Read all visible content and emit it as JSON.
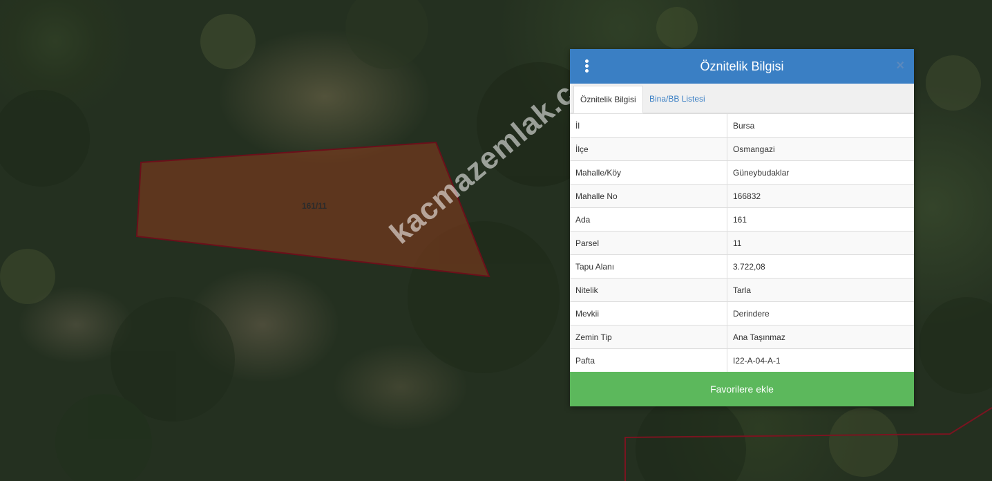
{
  "map": {
    "parcel_label": "161/11",
    "watermark": "kacmazemlak.com"
  },
  "panel": {
    "title": "Öznitelik Bilgisi",
    "close_label": "×",
    "tabs": [
      {
        "label": "Öznitelik Bilgisi",
        "active": true
      },
      {
        "label": "Bina/BB Listesi",
        "active": false
      }
    ],
    "rows": [
      {
        "key": "İl",
        "value": "Bursa"
      },
      {
        "key": "İlçe",
        "value": "Osmangazi"
      },
      {
        "key": "Mahalle/Köy",
        "value": "Güneybudaklar"
      },
      {
        "key": "Mahalle No",
        "value": "166832"
      },
      {
        "key": "Ada",
        "value": "161"
      },
      {
        "key": "Parsel",
        "value": "11"
      },
      {
        "key": "Tapu Alanı",
        "value": "3.722,08"
      },
      {
        "key": "Nitelik",
        "value": "Tarla"
      },
      {
        "key": "Mevkii",
        "value": "Derindere"
      },
      {
        "key": "Zemin Tip",
        "value": "Ana Taşınmaz"
      },
      {
        "key": "Pafta",
        "value": "I22-A-04-A-1"
      }
    ],
    "favorite_button": "Favorilere ekle"
  },
  "colors": {
    "header": "#3a7fc4",
    "button": "#5cb85c",
    "parcel_border": "#6b0f1a",
    "parcel_fill": "rgba(140,60,30,0.55)"
  },
  "icons": {
    "menu": "vertical-ellipsis-icon",
    "close": "close-icon"
  }
}
